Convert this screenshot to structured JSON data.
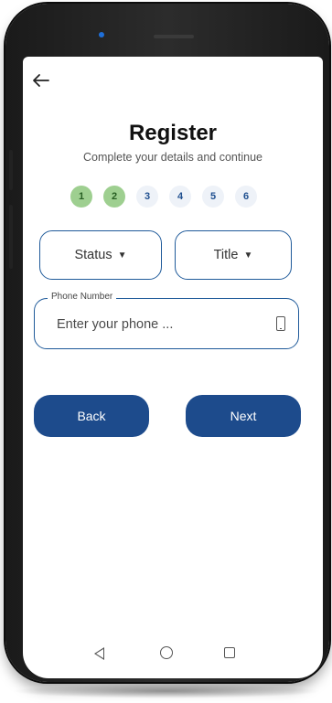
{
  "header": {
    "title": "Register",
    "subtitle": "Complete your details and continue"
  },
  "steps": [
    {
      "label": "1",
      "completed": true
    },
    {
      "label": "2",
      "completed": true
    },
    {
      "label": "3",
      "completed": false
    },
    {
      "label": "4",
      "completed": false
    },
    {
      "label": "5",
      "completed": false
    },
    {
      "label": "6",
      "completed": false
    }
  ],
  "form": {
    "status_label": "Status",
    "title_label": "Title",
    "phone": {
      "label": "Phone Number",
      "placeholder": "Enter your phone ...",
      "value": ""
    }
  },
  "actions": {
    "back_label": "Back",
    "next_label": "Next"
  },
  "icons": {
    "back": "arrow-left-icon",
    "dropdown": "caret-down-icon",
    "phone": "mobile-device-icon",
    "nav_back": "triangle-back-icon",
    "nav_home": "circle-home-icon",
    "nav_recent": "square-recent-icon"
  },
  "colors": {
    "primary": "#1d4b8c",
    "border": "#1f5a9a",
    "step_done": "#9ecf90",
    "step_pending": "#eef2f8"
  }
}
